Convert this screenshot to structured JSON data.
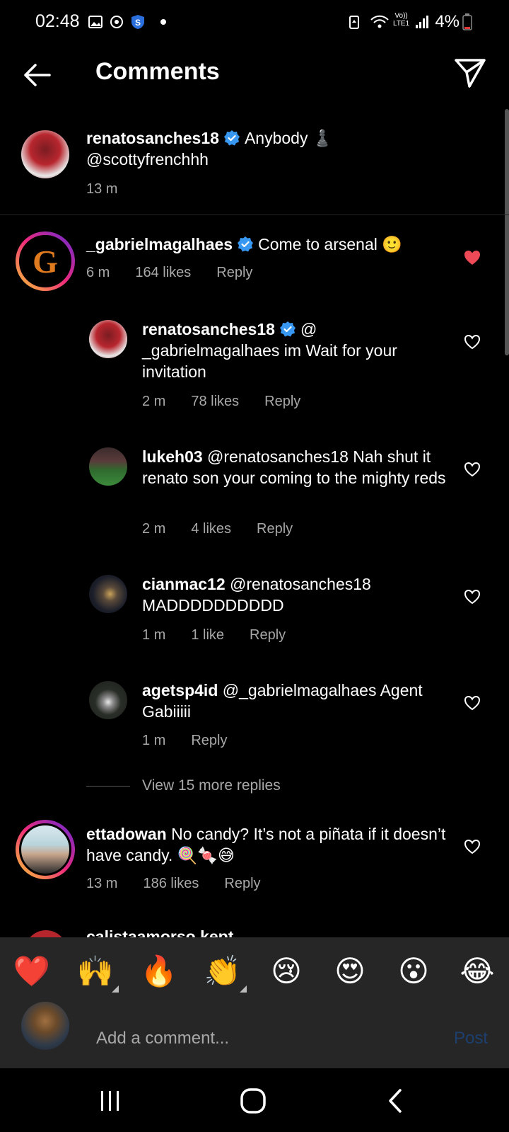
{
  "status_bar": {
    "time": "02:48",
    "battery": "4%",
    "icons": [
      "image-icon",
      "sync-icon",
      "shield-icon",
      "dot-icon",
      "battery-saver-icon",
      "wifi-icon",
      "volte-icon",
      "signal-icon",
      "battery-icon"
    ],
    "volte": "Vo))",
    "lte": "LTE1"
  },
  "header": {
    "title": "Comments"
  },
  "caption": {
    "user": "renatosanches18",
    "text": "Anybody ♟️ @scottyfrenchhh",
    "time": "13 m"
  },
  "comments": [
    {
      "user": "_gabrielmagalhaes",
      "text": "Come to arsenal 🙂",
      "time": "6 m",
      "likes": "164 likes",
      "reply": "Reply",
      "avatar_letter": "G",
      "liked": true
    },
    {
      "user": "ettadowan",
      "text": "No candy? It’s not a piñata if it doesn’t have candy. 🍭🍬😅",
      "time": "13 m",
      "likes": "186 likes",
      "reply": "Reply",
      "liked": false
    }
  ],
  "replies": [
    {
      "user": "renatosanches18",
      "text": "@ _gabrielmagalhaes  im Wait for your invitation",
      "time": "2 m",
      "likes": "78 likes",
      "reply": "Reply"
    },
    {
      "user": "lukeh03",
      "text": "@renatosanches18 Nah shut it renato son your coming to the mighty reds",
      "time": "2 m",
      "likes": "4 likes",
      "reply": "Reply"
    },
    {
      "user": "cianmac12",
      "text": "@renatosanches18 MADDDDDDDDDD",
      "time": "1 m",
      "likes": "1 like",
      "reply": "Reply"
    },
    {
      "user": "agetsp4id",
      "text": "@_gabrielmagalhaes Agent Gabiiiii",
      "time": "1 m",
      "reply": "Reply"
    }
  ],
  "view_more": "View 15 more replies",
  "peek_text": "calistaamorso kept ...",
  "reactions": [
    "❤️",
    "🙌",
    "🔥",
    "👏",
    "😢",
    "😍",
    "😮",
    "😂"
  ],
  "composer": {
    "placeholder": "Add a comment...",
    "post": "Post"
  },
  "colors": {
    "background": "#000000",
    "secondary_text": "#a8a8a8",
    "verified": "#3897f0",
    "liked_heart": "#ed4956",
    "post_disabled": "#1c3f6e",
    "panel": "#262626"
  }
}
